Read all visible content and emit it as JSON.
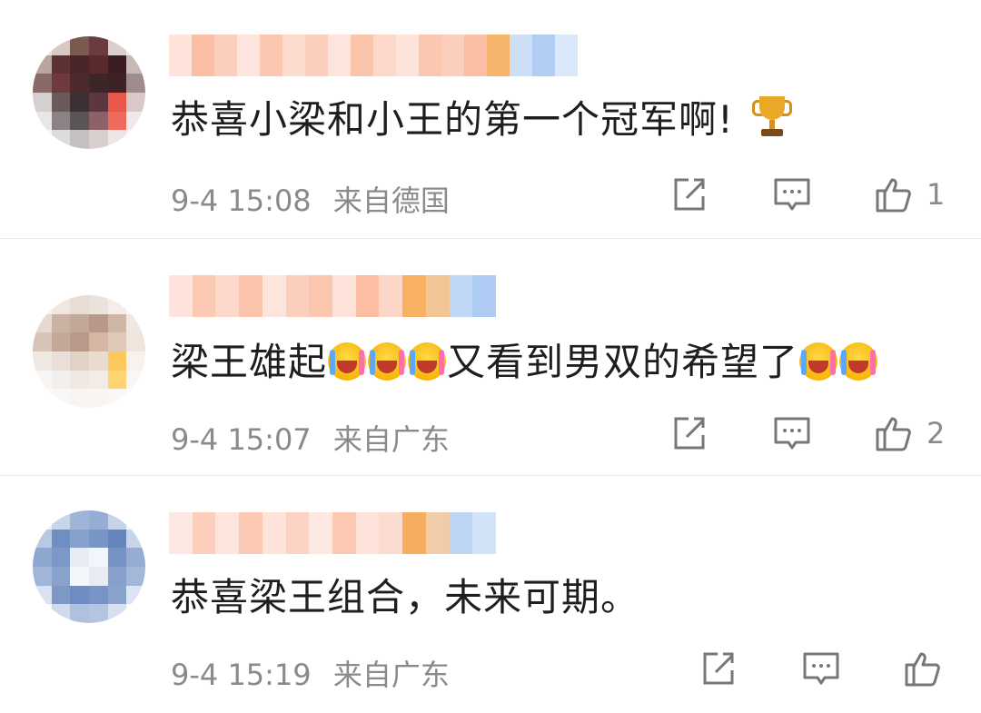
{
  "comments": [
    {
      "text": "恭喜小梁和小王的第一个冠军啊!",
      "time": "9-4 15:08",
      "location": "来自德国",
      "likes": "1"
    },
    {
      "text_part1": "梁王雄起",
      "text_part2": "又看到男双的希望了",
      "time": "9-4 15:07",
      "location": "来自广东",
      "likes": "2"
    },
    {
      "text": "恭喜梁王组合，未来可期。",
      "time": "9-4 15:19",
      "location": "来自广东"
    }
  ],
  "icons": {
    "share": "share-icon",
    "reply": "comment-icon",
    "like": "thumbs-up-icon",
    "trophy": "trophy-emoji",
    "cry_laugh": "crying-laughing-emoji"
  },
  "colors": {
    "text": "#1e1e1e",
    "meta": "#8a8a8a",
    "divider": "#e8e8e8",
    "icon": "#777777"
  }
}
